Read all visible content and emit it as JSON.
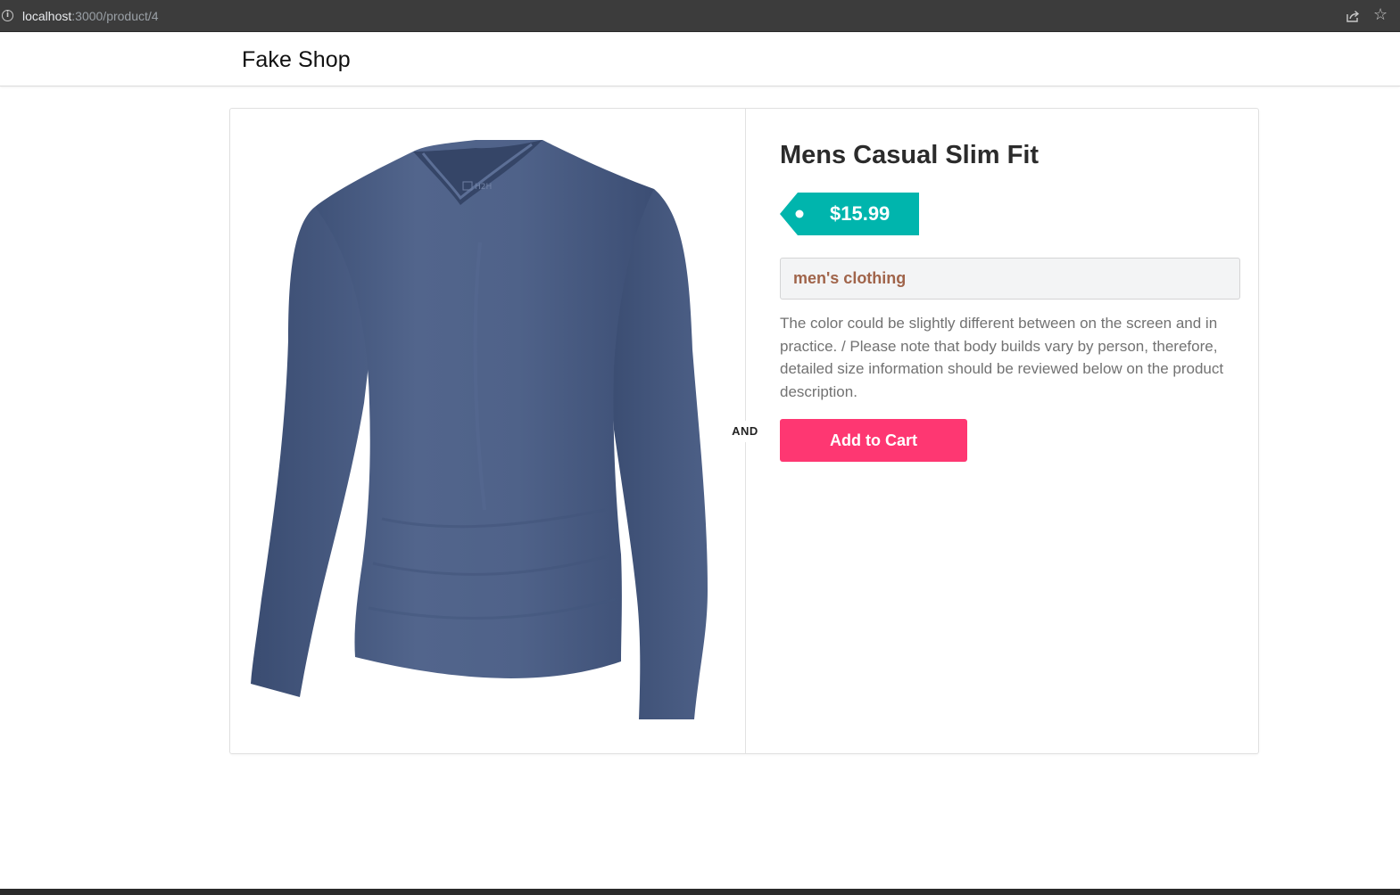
{
  "browser": {
    "url_host": "localhost",
    "url_rest": ":3000/product/4"
  },
  "header": {
    "brand": "Fake Shop"
  },
  "product": {
    "title": "Mens Casual Slim Fit",
    "price": "$15.99",
    "category": "men's clothing",
    "description": "The color could be slightly different between on the screen and in practice. / Please note that body builds vary by person, therefore, detailed size information should be reviewed below on the product description.",
    "divider_label": "AND",
    "add_to_cart_label": "Add to Cart",
    "image_logo_text": "H2H"
  },
  "colors": {
    "price_tag": "#00b5ad",
    "add_to_cart": "#fe3772",
    "category_text": "#a0644a",
    "shirt": "#4b5f86"
  }
}
